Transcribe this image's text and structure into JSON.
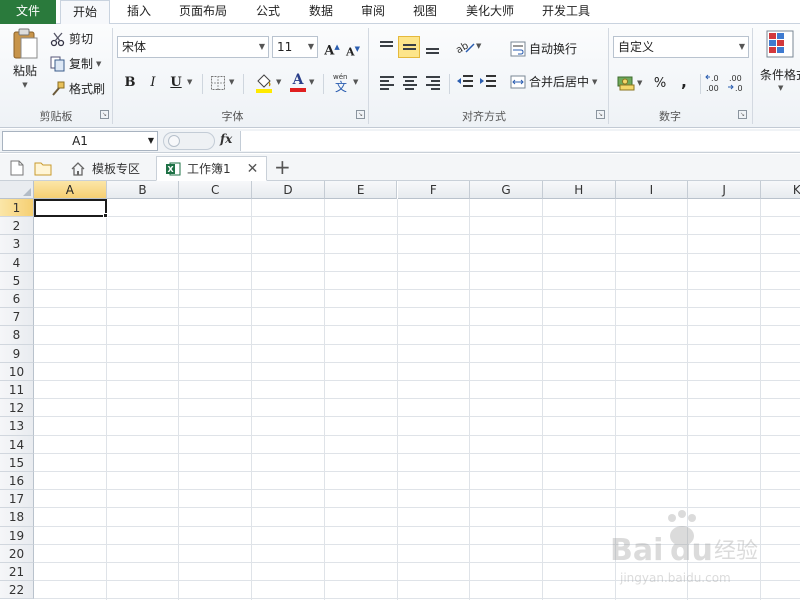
{
  "menu": {
    "file": "文件",
    "tabs": [
      "开始",
      "插入",
      "页面布局",
      "公式",
      "数据",
      "审阅",
      "视图",
      "美化大师",
      "开发工具"
    ]
  },
  "ribbon": {
    "clipboard": {
      "paste": "粘贴",
      "cut": "剪切",
      "copy": "复制",
      "format_painter": "格式刷",
      "label": "剪贴板"
    },
    "font": {
      "font_name": "宋体",
      "font_size": "11",
      "bold": "B",
      "italic": "I",
      "underline": "U",
      "grow": "A",
      "shrink": "A",
      "font_color_letter": "A",
      "label": "字体"
    },
    "alignment": {
      "wrap_text": "自动换行",
      "merge_center": "合并后居中",
      "label": "对齐方式"
    },
    "number": {
      "format": "自定义",
      "percent": "%",
      "comma": ",",
      "inc_decimal": "+.0\n.00",
      "label": "数字"
    },
    "styles": {
      "conditional": "条件格式"
    }
  },
  "formula_bar": {
    "name_box": "A1",
    "fx": "fx",
    "value": ""
  },
  "doc_tabs": {
    "templates": "模板专区",
    "workbook": "工作簿1",
    "add": "+"
  },
  "grid": {
    "columns": [
      "A",
      "B",
      "C",
      "D",
      "E",
      "F",
      "G",
      "H",
      "I",
      "J",
      "K"
    ],
    "rows": [
      "1",
      "2",
      "3",
      "4",
      "5",
      "6",
      "7",
      "8",
      "9",
      "10",
      "11",
      "12",
      "13",
      "14",
      "15",
      "16",
      "17",
      "18",
      "19",
      "20",
      "21",
      "22"
    ],
    "active_cell": "A1"
  },
  "colors": {
    "file_tab": "#2a7a3c",
    "selection_header": "#f6cf72",
    "font_color_bar": "#e02020",
    "highlight_bar": "#ffea00"
  }
}
